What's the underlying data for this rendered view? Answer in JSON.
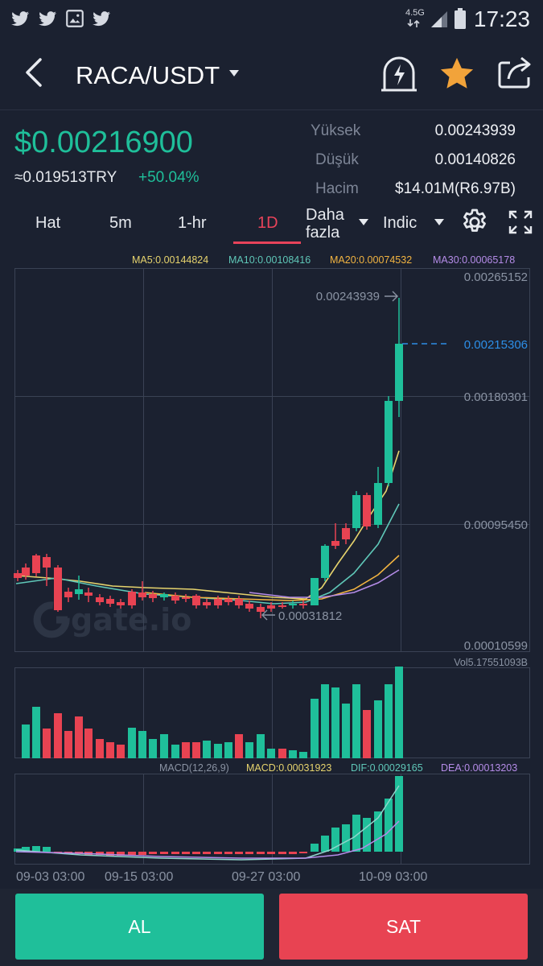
{
  "status": {
    "time": "17:23",
    "network": "4.5G"
  },
  "nav": {
    "pair": "RACA/USDT"
  },
  "price": {
    "last": "$0.00216900",
    "try": "≈0.019513TRY",
    "change": "+50.04%"
  },
  "stats": [
    {
      "label": "Yüksek",
      "value": "0.00243939"
    },
    {
      "label": "Düşük",
      "value": "0.00140826"
    },
    {
      "label": "Hacim",
      "value": "$14.01M(R6.97B)"
    }
  ],
  "tabs": {
    "line": "Hat",
    "m5": "5m",
    "hr1": "1-hr",
    "d1": "1D",
    "more_line1": "Daha",
    "more_line2": "fazla",
    "indic": "Indic"
  },
  "ma": {
    "ma5": "MA5:0.00144824",
    "ma10": "MA10:0.00108416",
    "ma20": "MA20:0.00074532",
    "ma30": "MA30:0.00065178"
  },
  "axis": {
    "y1": "0.00265152",
    "y2": "0.00215306",
    "y3": "0.00180301",
    "y4": "0.00095450",
    "y5": "0.00010599",
    "hi_mark": "0.00243939",
    "lo_mark": "0.00031812"
  },
  "vol_label": "Vol5.17551093B",
  "macd": {
    "title": "MACD(12,26,9)",
    "macd": "MACD:0.00031923",
    "dif": "DIF:0.00029165",
    "dea": "DEA:0.00013203"
  },
  "xaxis": {
    "d1": "09-03 03:00",
    "d2": "09-15 03:00",
    "d3": "09-27 03:00",
    "d4": "10-09 03:00"
  },
  "watermark": "gate.io",
  "buttons": {
    "buy": "AL",
    "sell": "SAT"
  },
  "colors": {
    "up": "#1fbf9a",
    "down": "#e84352",
    "accent_red": "#e8435a",
    "buy": "#1fbf9a",
    "sell": "#e84352"
  }
}
